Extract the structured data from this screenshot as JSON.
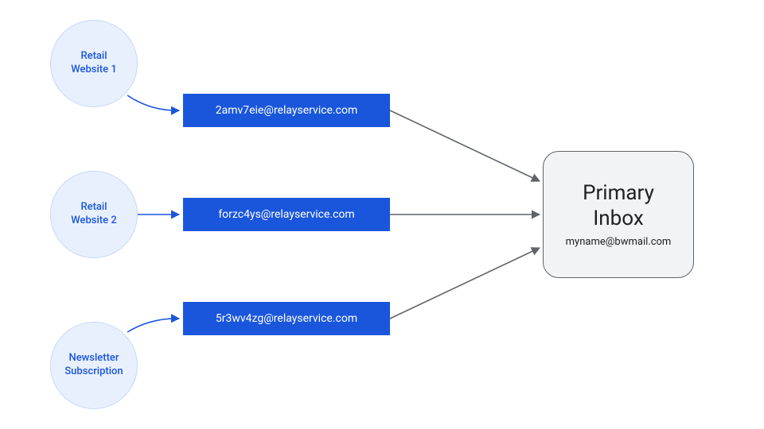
{
  "sources": [
    {
      "label": "Retail\nWebsite 1"
    },
    {
      "label": "Retail\nWebsite 2"
    },
    {
      "label": "Newsletter\nSubscription"
    }
  ],
  "relays": [
    {
      "email": "2amv7eie@relayservice.com"
    },
    {
      "email": "forzc4ys@relayservice.com"
    },
    {
      "email": "5r3wv4zg@relayservice.com"
    }
  ],
  "inbox": {
    "title": "Primary\nInbox",
    "email": "myname@bwmail.com"
  },
  "colors": {
    "circle_fill": "#E8F0FE",
    "circle_text": "#1A56DB",
    "relay_fill": "#1A56DB",
    "relay_text": "#FFFFFF",
    "inbox_fill": "#F1F3F4",
    "inbox_border": "#5F6368",
    "arrow_blue": "#1A56DB",
    "arrow_gray": "#5F6368"
  }
}
